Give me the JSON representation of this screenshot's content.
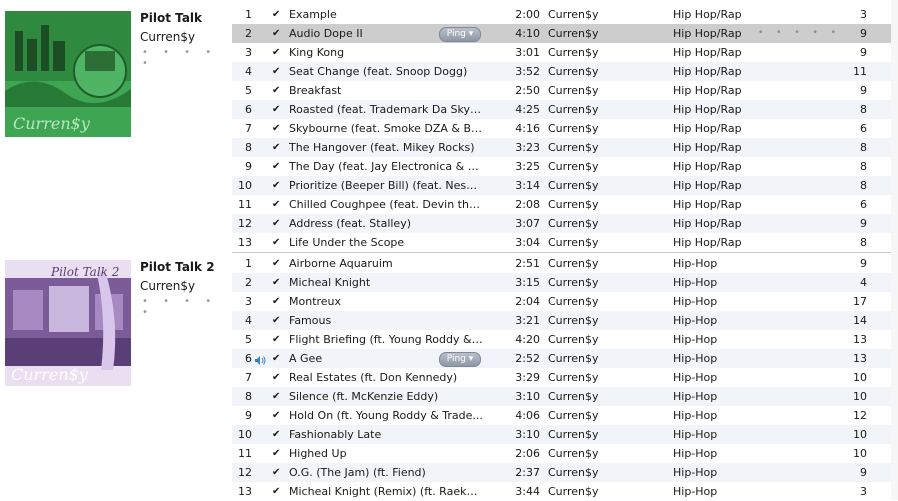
{
  "albums": [
    {
      "title": "Pilot Talk",
      "artist": "Curren$y",
      "rating_dots": "• • • • •",
      "art_text": "Curren$y",
      "tracks": [
        {
          "num": "1",
          "name": "Example",
          "time": "2:00",
          "artist": "Curren$y",
          "genre": "Hip Hop/Rap",
          "plays": "3"
        },
        {
          "num": "2",
          "name": "Audio Dope II",
          "time": "4:10",
          "artist": "Curren$y",
          "genre": "Hip Hop/Rap",
          "plays": "9",
          "selected": true,
          "ping": "Ping ▾",
          "dots": "• • • • •"
        },
        {
          "num": "3",
          "name": "King Kong",
          "time": "3:01",
          "artist": "Curren$y",
          "genre": "Hip Hop/Rap",
          "plays": "9"
        },
        {
          "num": "4",
          "name": "Seat Change (feat. Snoop Dogg)",
          "time": "3:52",
          "artist": "Curren$y",
          "genre": "Hip Hop/Rap",
          "plays": "11"
        },
        {
          "num": "5",
          "name": "Breakfast",
          "time": "2:50",
          "artist": "Curren$y",
          "genre": "Hip Hop/Rap",
          "plays": "9"
        },
        {
          "num": "6",
          "name": "Roasted (feat. Trademark Da Skydiv...",
          "time": "4:25",
          "artist": "Curren$y",
          "genre": "Hip Hop/Rap",
          "plays": "8"
        },
        {
          "num": "7",
          "name": "Skybourne (feat. Smoke DZA & Big ...",
          "time": "4:16",
          "artist": "Curren$y",
          "genre": "Hip Hop/Rap",
          "plays": "6"
        },
        {
          "num": "8",
          "name": "The Hangover (feat. Mikey Rocks)",
          "time": "3:23",
          "artist": "Curren$y",
          "genre": "Hip Hop/Rap",
          "plays": "8"
        },
        {
          "num": "9",
          "name": "The Day (feat. Jay Electronica & Mo...",
          "time": "3:25",
          "artist": "Curren$y",
          "genre": "Hip Hop/Rap",
          "plays": "8"
        },
        {
          "num": "10",
          "name": "Prioritize (Beeper Bill) (feat. Nesbey ...",
          "time": "3:14",
          "artist": "Curren$y",
          "genre": "Hip Hop/Rap",
          "plays": "8"
        },
        {
          "num": "11",
          "name": "Chilled Coughpee (feat. Devin the ...",
          "time": "2:08",
          "artist": "Curren$y",
          "genre": "Hip Hop/Rap",
          "plays": "6"
        },
        {
          "num": "12",
          "name": "Address (feat. Stalley)",
          "time": "3:07",
          "artist": "Curren$y",
          "genre": "Hip Hop/Rap",
          "plays": "9"
        },
        {
          "num": "13",
          "name": "Life Under the Scope",
          "time": "3:04",
          "artist": "Curren$y",
          "genre": "Hip Hop/Rap",
          "plays": "8"
        }
      ]
    },
    {
      "title": "Pilot Talk 2",
      "artist": "Curren$y",
      "rating_dots": "• • • • •",
      "art_text": "Curren$y",
      "art_title": "Pilot Talk 2",
      "tracks": [
        {
          "num": "1",
          "name": "Airborne Aquaruim",
          "time": "2:51",
          "artist": "Curren$y",
          "genre": "Hip-Hop",
          "plays": "9"
        },
        {
          "num": "2",
          "name": "Micheal Knight",
          "time": "3:15",
          "artist": "Curren$y",
          "genre": "Hip-Hop",
          "plays": "4"
        },
        {
          "num": "3",
          "name": "Montreux",
          "time": "2:04",
          "artist": "Curren$y",
          "genre": "Hip-Hop",
          "plays": "17"
        },
        {
          "num": "4",
          "name": "Famous",
          "time": "3:21",
          "artist": "Curren$y",
          "genre": "Hip-Hop",
          "plays": "14"
        },
        {
          "num": "5",
          "name": "Flight Briefing (ft. Young Roddy & ...",
          "time": "4:20",
          "artist": "Curren$y",
          "genre": "Hip-Hop",
          "plays": "13"
        },
        {
          "num": "6",
          "name": "A Gee",
          "time": "2:52",
          "artist": "Curren$y",
          "genre": "Hip-Hop",
          "plays": "13",
          "playing": true,
          "ping": "Ping ▾"
        },
        {
          "num": "7",
          "name": "Real Estates (ft. Don Kennedy)",
          "time": "3:29",
          "artist": "Curren$y",
          "genre": "Hip-Hop",
          "plays": "10"
        },
        {
          "num": "8",
          "name": "Silence (ft. McKenzie Eddy)",
          "time": "3:10",
          "artist": "Curren$y",
          "genre": "Hip-Hop",
          "plays": "10"
        },
        {
          "num": "9",
          "name": "Hold On (ft. Young Roddy & Trade...",
          "time": "4:06",
          "artist": "Curren$y",
          "genre": "Hip-Hop",
          "plays": "12"
        },
        {
          "num": "10",
          "name": "Fashionably Late",
          "time": "3:10",
          "artist": "Curren$y",
          "genre": "Hip-Hop",
          "plays": "10"
        },
        {
          "num": "11",
          "name": "Highed Up",
          "time": "2:06",
          "artist": "Curren$y",
          "genre": "Hip-Hop",
          "plays": "10"
        },
        {
          "num": "12",
          "name": "O.G. (The Jam) (ft. Fiend)",
          "time": "2:37",
          "artist": "Curren$y",
          "genre": "Hip-Hop",
          "plays": "9"
        },
        {
          "num": "13",
          "name": "Micheal Knight (Remix) (ft. Raekwon)",
          "time": "3:44",
          "artist": "Curren$y",
          "genre": "Hip-Hop",
          "plays": "3"
        }
      ]
    }
  ],
  "icons": {
    "check": "check-icon",
    "speaker": "speaker-icon",
    "ping": "ping-dropdown"
  },
  "colors": {
    "selected_row": "#cdcdcd",
    "alt_row": "#f1f4f8",
    "album1_art": "#3f9a4c",
    "album2_art": "#8a6fa3"
  }
}
